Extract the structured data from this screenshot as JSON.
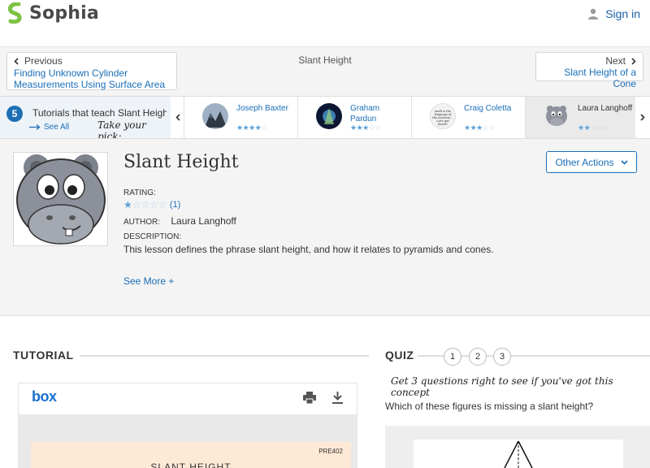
{
  "header": {
    "brand": "Sophia",
    "signin_label": "Sign in",
    "accent": "#7cc243"
  },
  "nav": {
    "prev_label": "Previous",
    "prev_title": "Finding Unknown Cylinder Measurements Using Surface Area",
    "current_title": "Slant Height",
    "next_label": "Next",
    "next_title": "Slant Height of a Cone"
  },
  "tutorials": {
    "count": "5",
    "title": "Tutorials that teach Slant Height",
    "see_all": "See All",
    "take_pick": "Take your pick:",
    "cards": [
      {
        "name": "Joseph Baxter",
        "rating": 4
      },
      {
        "name": "Graham Pardun",
        "rating": 3
      },
      {
        "name": "Craig Coletta",
        "rating": 3
      },
      {
        "name": "Laura Langhoff",
        "rating": 2
      }
    ],
    "avatar_text": "math is the language of the universe... Let's get fluent!"
  },
  "lesson": {
    "title": "Slant Height",
    "other_actions": "Other Actions",
    "rating_label": "RATING:",
    "rating_value": 1,
    "rating_count": "(1)",
    "author_label": "AUTHOR:",
    "author": "Laura Langhoff",
    "description_label": "DESCRIPTION:",
    "description": "This lesson defines the phrase slant height, and how it relates to pyramids and cones.",
    "see_more": "See More +"
  },
  "tutorial_section": {
    "title": "TUTORIAL",
    "viewer_brand": "box",
    "doc_code": "PRE402",
    "doc_heading": "SLANT HEIGHT"
  },
  "quiz": {
    "title": "QUIZ",
    "numbers": [
      "1",
      "2",
      "3"
    ],
    "tagline": "Get 3 questions right to see if you've got this concept",
    "question": "Which of these figures is missing a slant height?"
  }
}
